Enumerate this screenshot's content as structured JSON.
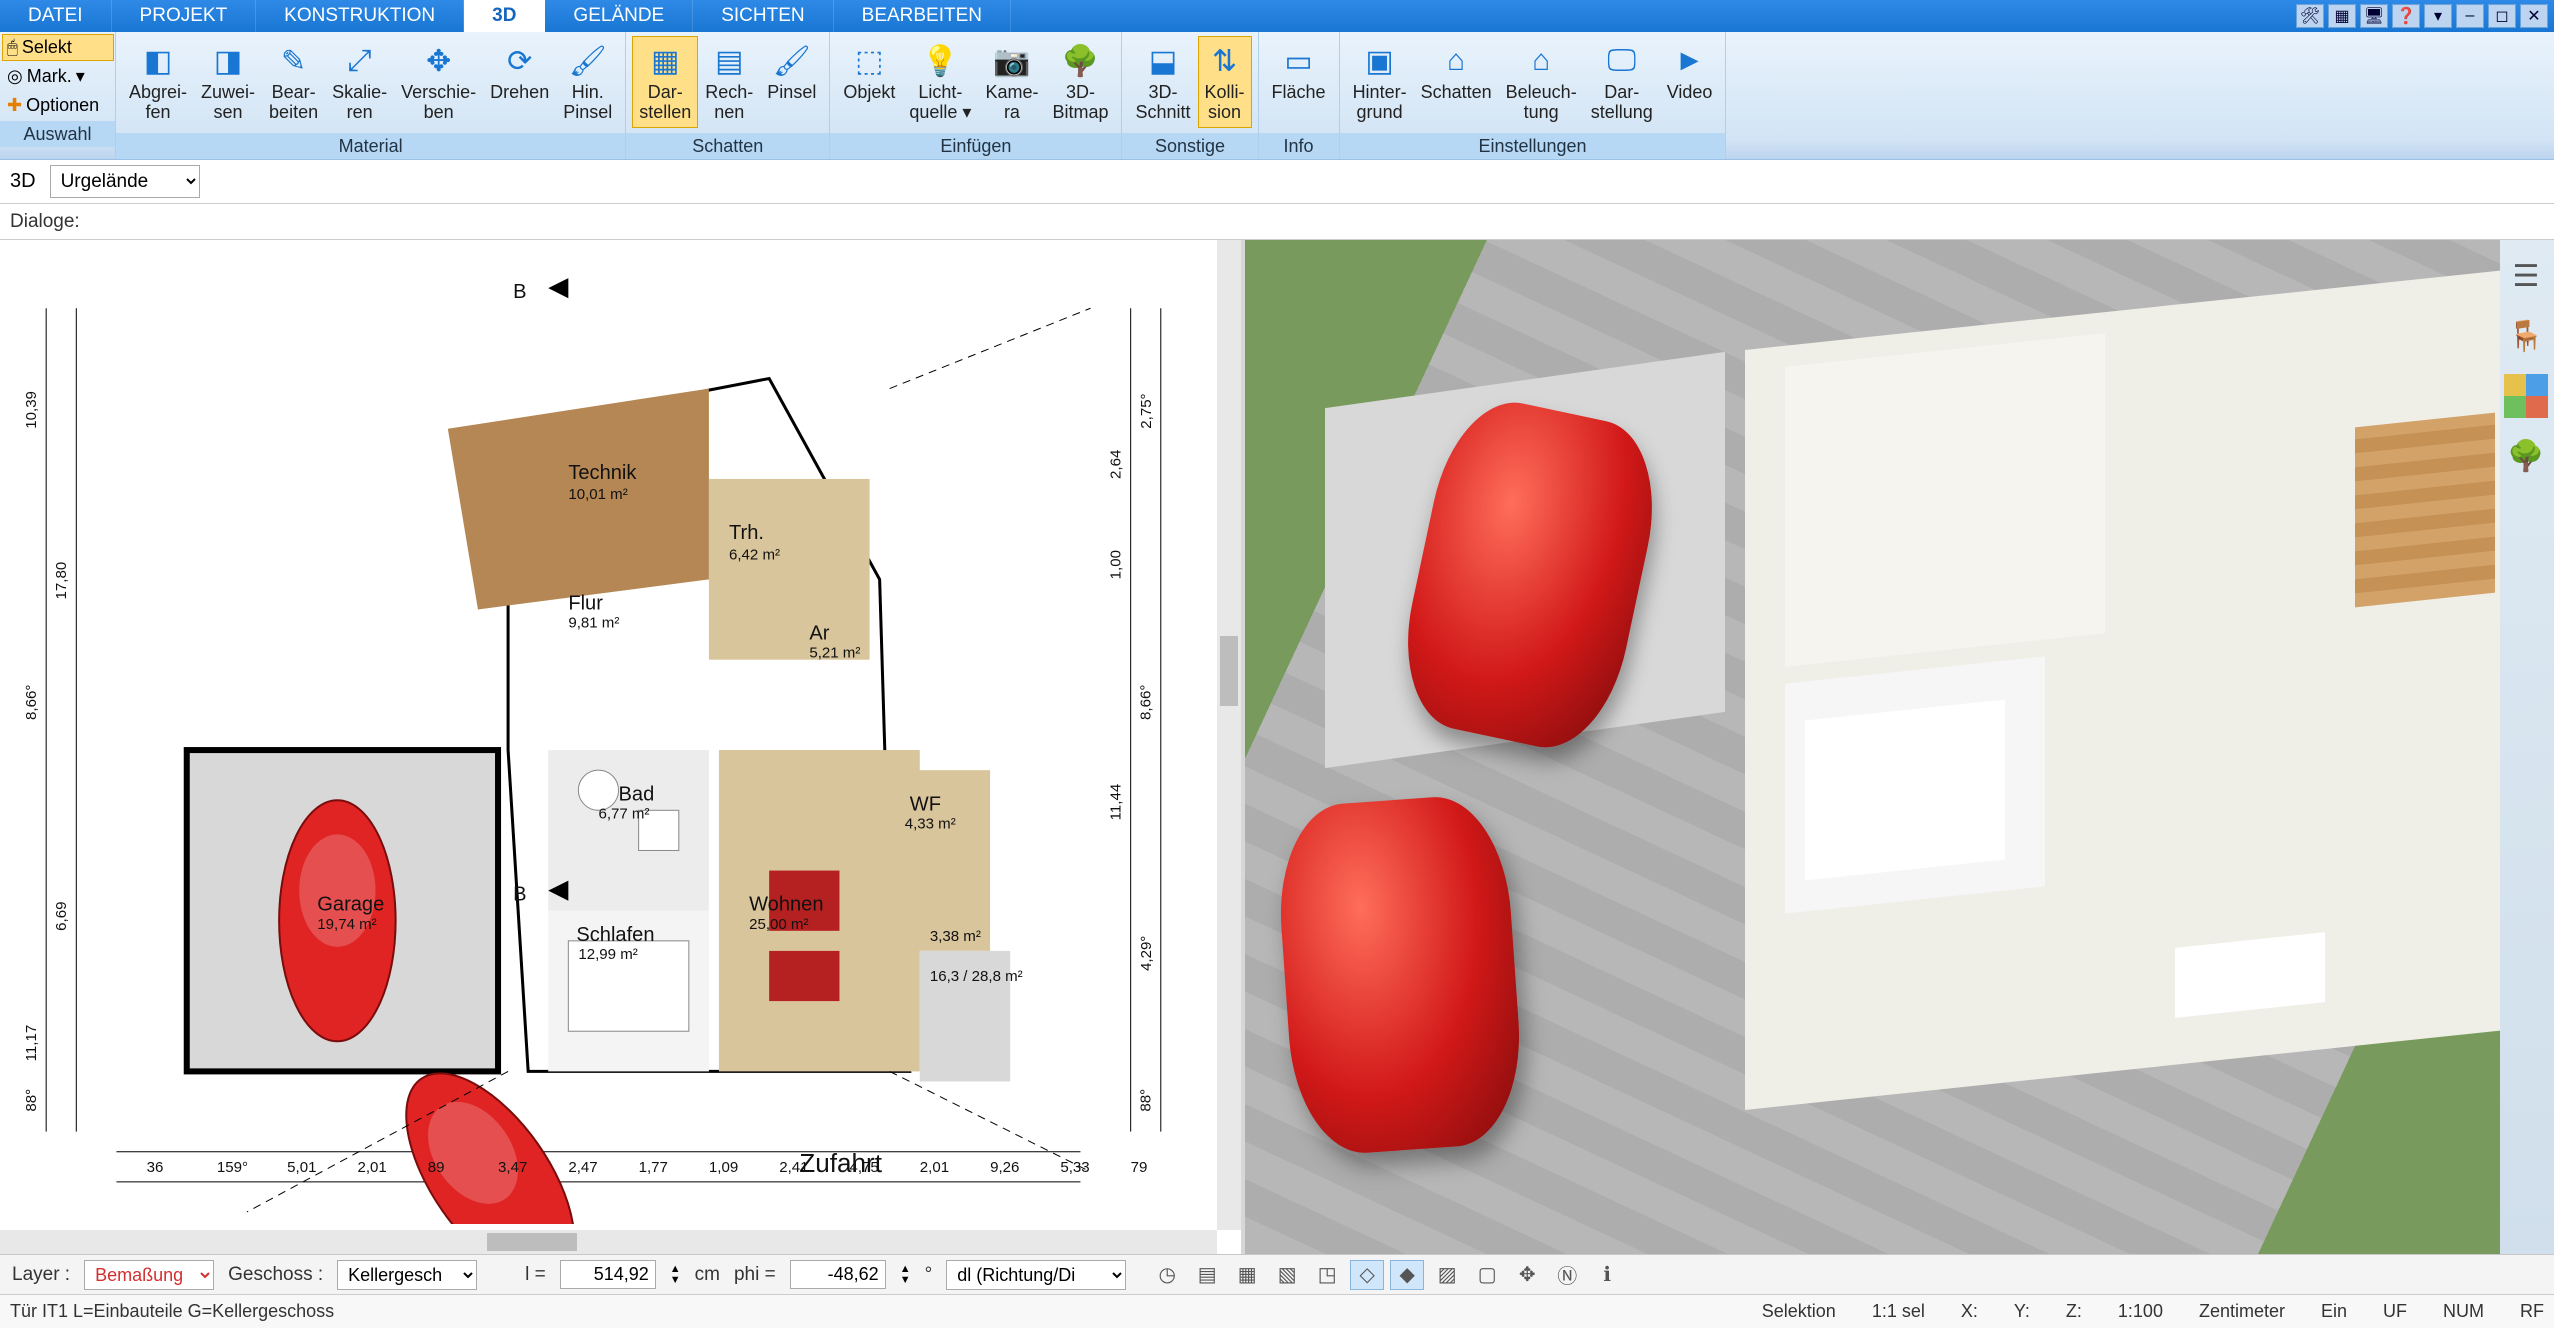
{
  "menu": {
    "tabs": [
      "DATEI",
      "PROJEKT",
      "KONSTRUKTION",
      "3D",
      "GELÄNDE",
      "SICHTEN",
      "BEARBEITEN"
    ],
    "active": 3
  },
  "selectPanel": {
    "selekt": "Selekt",
    "mark": "Mark.",
    "optionen": "Optionen",
    "group": "Auswahl"
  },
  "ribbon": {
    "groups": [
      {
        "label": "Material",
        "items": [
          {
            "label": "Abgrei-\nfen",
            "icon": "◧"
          },
          {
            "label": "Zuwei-\nsen",
            "icon": "◨"
          },
          {
            "label": "Bear-\nbeiten",
            "icon": "✎"
          },
          {
            "label": "Skalie-\nren",
            "icon": "⤢"
          },
          {
            "label": "Verschie-\nben",
            "icon": "✥"
          },
          {
            "label": "Drehen",
            "icon": "⟳"
          },
          {
            "label": "Hin.\nPinsel",
            "icon": "🖌"
          }
        ]
      },
      {
        "label": "Schatten",
        "items": [
          {
            "label": "Dar-\nstellen",
            "icon": "▦",
            "active": true
          },
          {
            "label": "Rech-\nnen",
            "icon": "▤"
          },
          {
            "label": "Pinsel",
            "icon": "🖌"
          }
        ]
      },
      {
        "label": "Einfügen",
        "items": [
          {
            "label": "Objekt",
            "icon": "⬚"
          },
          {
            "label": "Licht-\nquelle ▾",
            "icon": "💡"
          },
          {
            "label": "Kame-\nra",
            "icon": "📷"
          },
          {
            "label": "3D-\nBitmap",
            "icon": "🌳"
          }
        ]
      },
      {
        "label": "Sonstige",
        "items": [
          {
            "label": "3D-\nSchnitt",
            "icon": "⬓"
          },
          {
            "label": "Kolli-\nsion",
            "icon": "⇅",
            "active": true
          }
        ]
      },
      {
        "label": "Info",
        "items": [
          {
            "label": "Fläche",
            "icon": "▭"
          }
        ]
      },
      {
        "label": "Einstellungen",
        "items": [
          {
            "label": "Hinter-\ngrund",
            "icon": "▣"
          },
          {
            "label": "Schatten",
            "icon": "⌂"
          },
          {
            "label": "Beleuch-\ntung",
            "icon": "⌂"
          },
          {
            "label": "Dar-\nstellung",
            "icon": "🖵"
          },
          {
            "label": "Video",
            "icon": "►"
          }
        ]
      }
    ]
  },
  "top": {
    "mode": "3D",
    "layer_select": "Urgelände",
    "dialoge": "Dialoge:"
  },
  "rooms": {
    "technik": {
      "name": "Technik",
      "area": "10,01 m²"
    },
    "trh": {
      "name": "Trh.",
      "area": "6,42 m²"
    },
    "flur": {
      "name": "Flur",
      "area": "9,81 m²"
    },
    "ar": {
      "name": "Ar",
      "area": "5,21 m²"
    },
    "bad": {
      "name": "Bad",
      "area": "6,77 m²"
    },
    "wf": {
      "name": "WF",
      "area": "4,33 m²"
    },
    "schlafen": {
      "name": "Schlafen",
      "area": "12,99 m²"
    },
    "wohnen": {
      "name": "Wohnen",
      "area": "25,00 m²"
    },
    "garage": {
      "name": "Garage",
      "area": "19,74 m²"
    },
    "terr": {
      "area": "3,38 m²"
    },
    "terr2": {
      "area": "16,3 / 28,8\nm²"
    },
    "zufahrt": "Zufahrt"
  },
  "dims": {
    "left_v1": "10,39",
    "left_v2": "17,80",
    "left_v3": "6,69",
    "left_v4": "8,66°",
    "left_v5": "88°",
    "left_b": "11,17",
    "right_v1": "2,75°",
    "right_v2": "2,64",
    "right_v3": "1,00",
    "right_v4": "8,66°",
    "right_v5": "11,44",
    "right_v6": "4,29°",
    "right_v7": "88°",
    "bot": [
      "36",
      "159°",
      "5,01",
      "2,01",
      "89",
      "3,47",
      "2,47",
      "1,77",
      "1,09",
      "2,41",
      "4,75",
      "2,01",
      "9,26",
      "5,33",
      "79"
    ],
    "sectB": "B"
  },
  "bottom": {
    "layer_label": "Layer :",
    "layer_value": "Bemaßung",
    "geschoss_label": "Geschoss :",
    "geschoss_value": "Kellergesch",
    "l_label": "l =",
    "l_value": "514,92",
    "l_unit": "cm",
    "phi_label": "phi =",
    "phi_value": "-48,62",
    "phi_unit": "°",
    "dl_value": "dl (Richtung/Di"
  },
  "status": {
    "left": "Tür IT1 L=Einbauteile G=Kellergeschoss",
    "sel": "Selektion",
    "ratio": "1:1 sel",
    "x": "X:",
    "y": "Y:",
    "z": "Z:",
    "scale": "1:100",
    "unit": "Zentimeter",
    "ein": "Ein",
    "uf": "UF",
    "num": "NUM",
    "rf": "RF"
  }
}
